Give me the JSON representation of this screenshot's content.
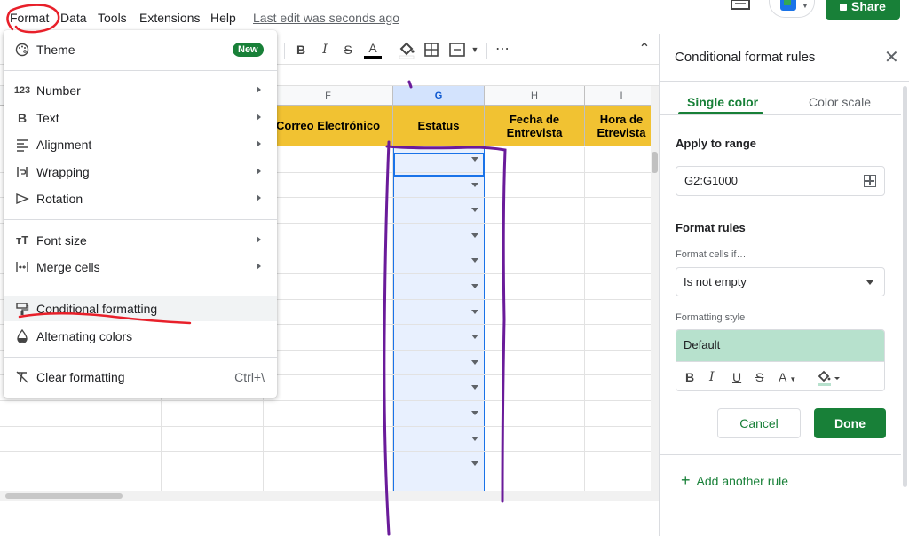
{
  "menubar": {
    "items": [
      "Format",
      "Data",
      "Tools",
      "Extensions",
      "Help"
    ],
    "last_edit": "Last edit was seconds ago",
    "share_label": "Share"
  },
  "toolbar": {
    "bold": "B",
    "italic": "I",
    "strike": "S",
    "text_color": "A",
    "more": "⋯",
    "collapse": "⌃"
  },
  "grid": {
    "columns": [
      "F",
      "G",
      "H",
      "I"
    ],
    "headers": [
      "Correo Electrónico",
      "Estatus",
      "Fecha de Entrevista",
      "Hora de Etrevista"
    ]
  },
  "format_menu": {
    "theme": "Theme",
    "new_badge": "New",
    "number": "Number",
    "text": "Text",
    "alignment": "Alignment",
    "wrapping": "Wrapping",
    "rotation": "Rotation",
    "font_size": "Font size",
    "merge_cells": "Merge cells",
    "conditional_formatting": "Conditional formatting",
    "alternating_colors": "Alternating colors",
    "clear_formatting": "Clear formatting",
    "clear_shortcut": "Ctrl+\\"
  },
  "panel": {
    "title": "Conditional format rules",
    "tab_single": "Single color",
    "tab_scale": "Color scale",
    "apply_to_range": "Apply to range",
    "range_value": "G2:G1000",
    "format_rules": "Format rules",
    "format_cells_if": "Format cells if…",
    "condition": "Is not empty",
    "formatting_style": "Formatting style",
    "style_default": "Default",
    "style_tools": [
      "B",
      "I",
      "U",
      "S",
      "A"
    ],
    "cancel": "Cancel",
    "done": "Done",
    "add_rule": "Add another rule"
  },
  "colors": {
    "header_fill": "#f1c232",
    "accent_green": "#188038",
    "selection_blue": "#1a73e8",
    "preview_green": "#b7e1cd",
    "annotation_red": "#e8202a",
    "annotation_purple": "#6a1b9a"
  }
}
